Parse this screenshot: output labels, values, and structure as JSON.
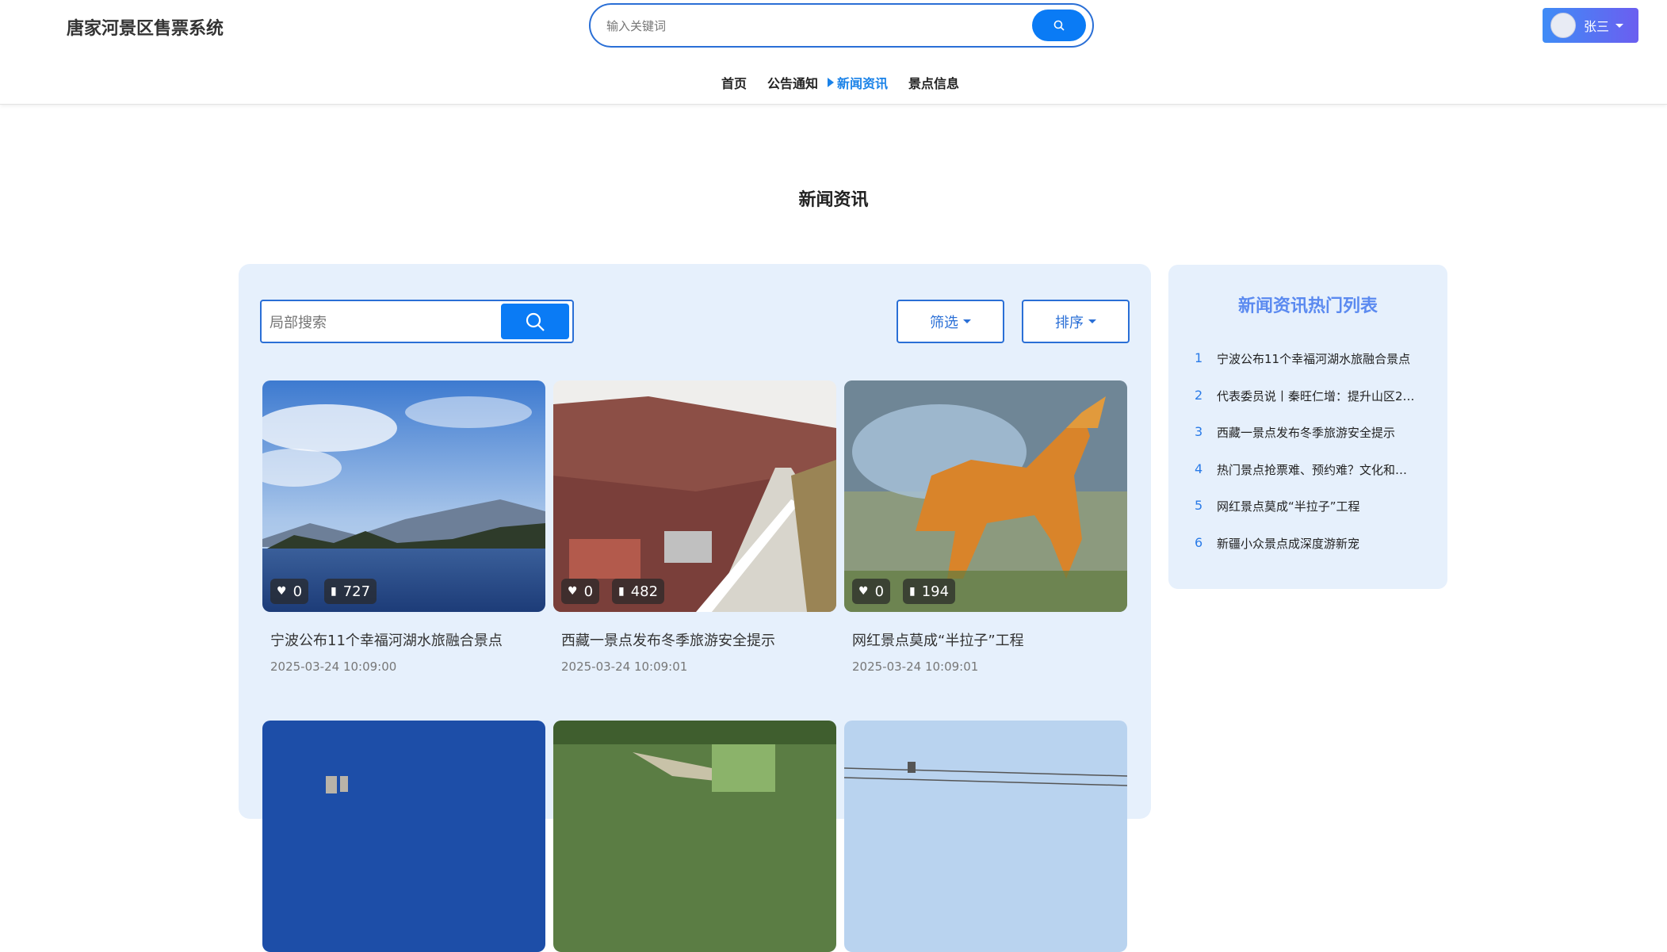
{
  "header": {
    "site_title": "唐家河景区售票系统",
    "search_placeholder": "输入关键词",
    "user_name": "张三"
  },
  "nav": {
    "items": [
      {
        "label": "首页",
        "active": false
      },
      {
        "label": "公告通知",
        "active": false
      },
      {
        "label": "新闻资讯",
        "active": true
      },
      {
        "label": "景点信息",
        "active": false
      }
    ]
  },
  "page": {
    "section_title": "新闻资讯",
    "local_search_placeholder": "局部搜索",
    "filter_label": "筛选",
    "sort_label": "排序"
  },
  "news_cards": [
    {
      "title": "宁波公布11个幸福河湖水旅融合景点",
      "date": "2025-03-24 10:09:00",
      "likes": "0",
      "collects": "727"
    },
    {
      "title": "西藏一景点发布冬季旅游安全提示",
      "date": "2025-03-24 10:09:01",
      "likes": "0",
      "collects": "482"
    },
    {
      "title": "网红景点莫成“半拉子”工程",
      "date": "2025-03-24 10:09:01",
      "likes": "0",
      "collects": "194"
    }
  ],
  "hot_list": {
    "title": "新闻资讯热门列表",
    "items": [
      {
        "num": "1",
        "text": "宁波公布11个幸福河湖水旅融合景点"
      },
      {
        "num": "2",
        "text": "代表委员说丨秦旺仁增：提升山区2…"
      },
      {
        "num": "3",
        "text": "西藏一景点发布冬季旅游安全提示"
      },
      {
        "num": "4",
        "text": "热门景点抢票难、预约难？文化和…"
      },
      {
        "num": "5",
        "text": "网红景点莫成“半拉子”工程"
      },
      {
        "num": "6",
        "text": "新疆小众景点成深度游新宠"
      }
    ]
  },
  "colors": {
    "primary": "#0a7bf5",
    "panel_bg": "#e6f0fc",
    "hot_title": "#5b8af0"
  }
}
